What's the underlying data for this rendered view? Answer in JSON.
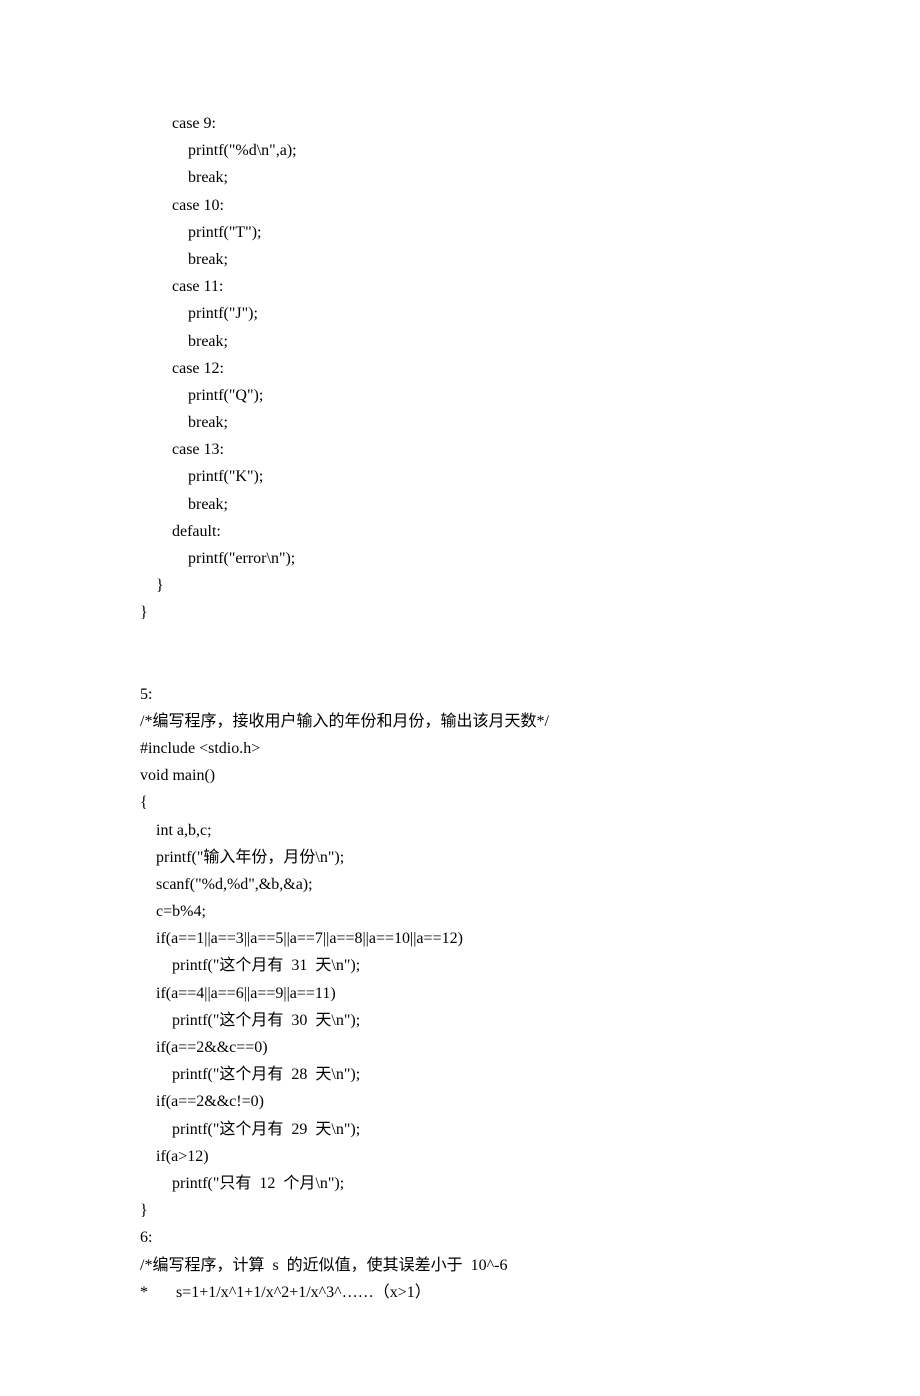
{
  "code1": [
    "        case 9:",
    "            printf(\"%d\\n\",a);",
    "            break;",
    "        case 10:",
    "            printf(\"T\");",
    "            break;",
    "        case 11:",
    "            printf(\"J\");",
    "            break;",
    "        case 12:",
    "            printf(\"Q\");",
    "            break;",
    "        case 13:",
    "            printf(\"K\");",
    "            break;",
    "        default:",
    "            printf(\"error\\n\");",
    "    }",
    "}"
  ],
  "section5": {
    "header": "5:",
    "comment": "/*编写程序，接收用户输入的年份和月份，输出该月天数*/",
    "code": [
      "#include <stdio.h>",
      "void main()",
      "{",
      "    int a,b,c;",
      "    printf(\"输入年份，月份\\n\");",
      "    scanf(\"%d,%d\",&b,&a);",
      "    c=b%4;",
      "    if(a==1||a==3||a==5||a==7||a==8||a==10||a==12)",
      "        printf(\"这个月有  31  天\\n\");",
      "    if(a==4||a==6||a==9||a==11)",
      "        printf(\"这个月有  30  天\\n\");",
      "    if(a==2&&c==0)",
      "        printf(\"这个月有  28  天\\n\");",
      "    if(a==2&&c!=0)",
      "        printf(\"这个月有  29  天\\n\");",
      "    if(a>12)",
      "        printf(\"只有  12  个月\\n\");",
      "}"
    ]
  },
  "section6": {
    "header": "6:",
    "comment1": "/*编写程序，计算  s  的近似值，使其误差小于  10^-6",
    "comment2": "*       s=1+1/x^1+1/x^2+1/x^3^……（x>1）"
  }
}
